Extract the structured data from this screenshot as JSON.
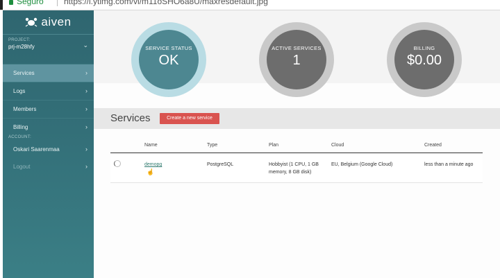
{
  "browser": {
    "secure_label": "Seguro",
    "url": "https://i.ytimg.com/vi/m11oSHO6a8U/maxresdefault.jpg"
  },
  "sidebar": {
    "brand": "aiven",
    "project_label": "PROJECT:",
    "project_value": "prj-m28hfy",
    "nav": [
      {
        "label": "Services",
        "active": true
      },
      {
        "label": "Logs",
        "active": false
      },
      {
        "label": "Members",
        "active": false
      },
      {
        "label": "Billing",
        "active": false
      }
    ],
    "account_label": "ACCOUNT:",
    "account_name": "Oskari Saarenmaa",
    "logout_label": "Logout"
  },
  "stats": {
    "service_status_label": "SERVICE STATUS",
    "service_status_value": "OK",
    "active_services_label": "ACTIVE SERVICES",
    "active_services_value": "1",
    "billing_label": "BILLING",
    "billing_value": "$0.00"
  },
  "services": {
    "title": "Services",
    "create_button": "Create a new service",
    "columns": [
      "Name",
      "Type",
      "Plan",
      "Cloud",
      "Created"
    ],
    "rows": [
      {
        "name": "demopg",
        "type": "PostgreSQL",
        "plan": "Hobbyist (1 CPU, 1 GB memory, 8 GB disk)",
        "cloud": "EU, Belgium (Google Cloud)",
        "created": "less than a minute ago"
      }
    ]
  },
  "colors": {
    "sidebar": "#336f78",
    "status_ok": "#4d8791",
    "gauge_gray": "#6d6d6d",
    "create_button": "#d9534f"
  }
}
